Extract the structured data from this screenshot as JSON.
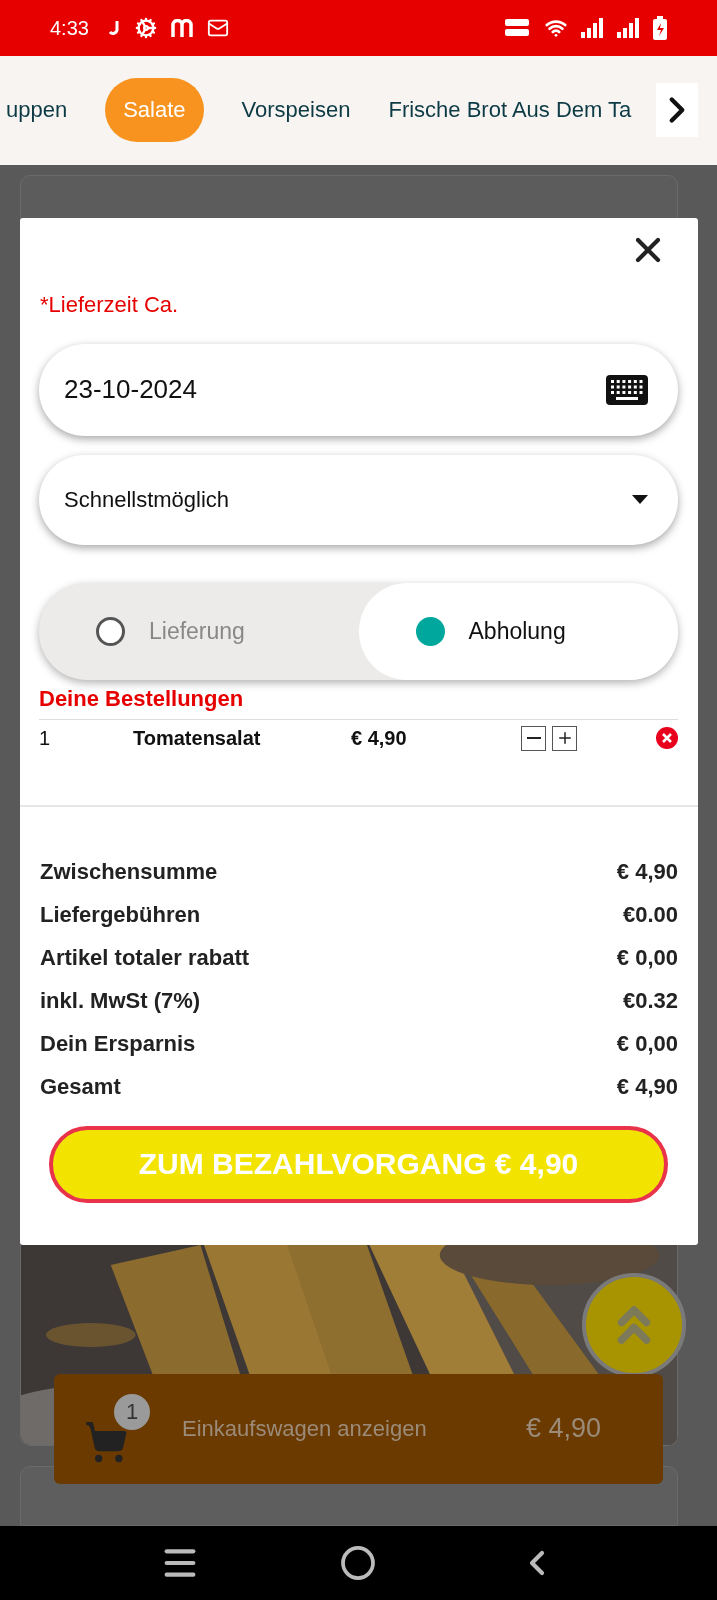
{
  "status_bar": {
    "time": "4:33"
  },
  "categories": [
    {
      "label": "uppen",
      "selected": false
    },
    {
      "label": "Salate",
      "selected": true
    },
    {
      "label": "Vorspeisen",
      "selected": false
    },
    {
      "label": "Frische Brot Aus Dem Ta",
      "selected": false
    }
  ],
  "dialog": {
    "delivery_time_label": "*Lieferzeit Ca.",
    "date_field": {
      "value": "23-10-2024"
    },
    "time_select": {
      "value": "Schnellstmöglich"
    },
    "order_type": [
      {
        "label": "Lieferung",
        "selected": false
      },
      {
        "label": "Abholung",
        "selected": true
      }
    ],
    "orders_title": "Deine Bestellungen",
    "orders": [
      {
        "qty": "1",
        "name": "Tomatensalat",
        "price": "€ 4,90"
      }
    ],
    "summary": [
      {
        "label": "Zwischensumme",
        "value": "€ 4,90"
      },
      {
        "label": "Liefergebühren",
        "value": "€0.00"
      },
      {
        "label": "Artikel totaler rabatt",
        "value": "€ 0,00"
      },
      {
        "label": "inkl. MwSt (7%)",
        "value": "€0.32"
      },
      {
        "label": "Dein Ersparnis",
        "value": "€ 0,00"
      },
      {
        "label": "Gesamt",
        "value": "€ 4,90"
      }
    ],
    "checkout_button": "ZUM BEZAHLVORGANG € 4,90"
  },
  "cart_bar": {
    "badge": "1",
    "label": "Einkaufswagen anzeigen",
    "total": "€ 4,90"
  }
}
